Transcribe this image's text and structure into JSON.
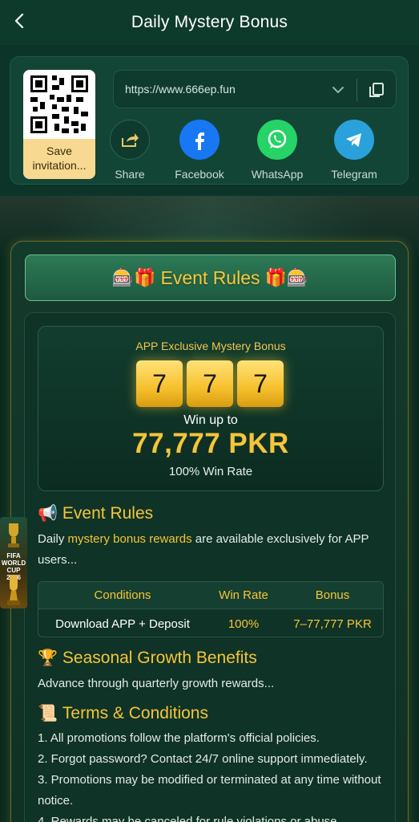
{
  "header": {
    "title": "Daily Mystery Bonus",
    "back_icon": "chevron-left-icon"
  },
  "share_panel": {
    "save_label": "Save invitation...",
    "url": "https://www.666ep.fun",
    "items": [
      {
        "label": "Share",
        "icon": "share-icon"
      },
      {
        "label": "Facebook",
        "icon": "facebook-icon",
        "color": "#1877f2"
      },
      {
        "label": "WhatsApp",
        "icon": "whatsapp-icon",
        "color": "#25d366"
      },
      {
        "label": "Telegram",
        "icon": "telegram-icon",
        "color": "#2aa1da"
      }
    ]
  },
  "event": {
    "banner_title": "Event Rules",
    "banner_emojis": [
      "🎰",
      "🎁"
    ],
    "jackpot": {
      "title": "APP Exclusive Mystery Bonus",
      "digits": [
        "7",
        "7",
        "7"
      ],
      "win_up_to": "Win up to",
      "amount": "77,777 PKR",
      "win_rate": "100% Win Rate"
    },
    "rules": {
      "heading": "Event Rules",
      "text_before": "Daily ",
      "text_highlight": "mystery bonus rewards",
      "text_after": " are available exclusively for APP users..."
    },
    "table": {
      "headers": [
        "Conditions",
        "Win Rate",
        "Bonus"
      ],
      "row": [
        "Download APP + Deposit",
        "100%",
        "7–77,777 PKR"
      ]
    },
    "seasonal": {
      "heading": "Seasonal Growth Benefits",
      "text": "Advance through quarterly growth rewards..."
    },
    "terms": {
      "heading": "Terms & Conditions",
      "items": [
        "1. All promotions follow the platform's official policies.",
        "2. Forgot password? Contact 24/7 online support immediately.",
        "3. Promotions may be modified or terminated at any time without notice.",
        "4. Rewards may be canceled for rule violations or abuse."
      ]
    }
  },
  "side_float": {
    "text": "FIFA WORLD CUP 2026"
  },
  "colors": {
    "accent": "#f6c53a",
    "header_bg": "#0e3a2c",
    "panel_bg": "#0f3326"
  }
}
